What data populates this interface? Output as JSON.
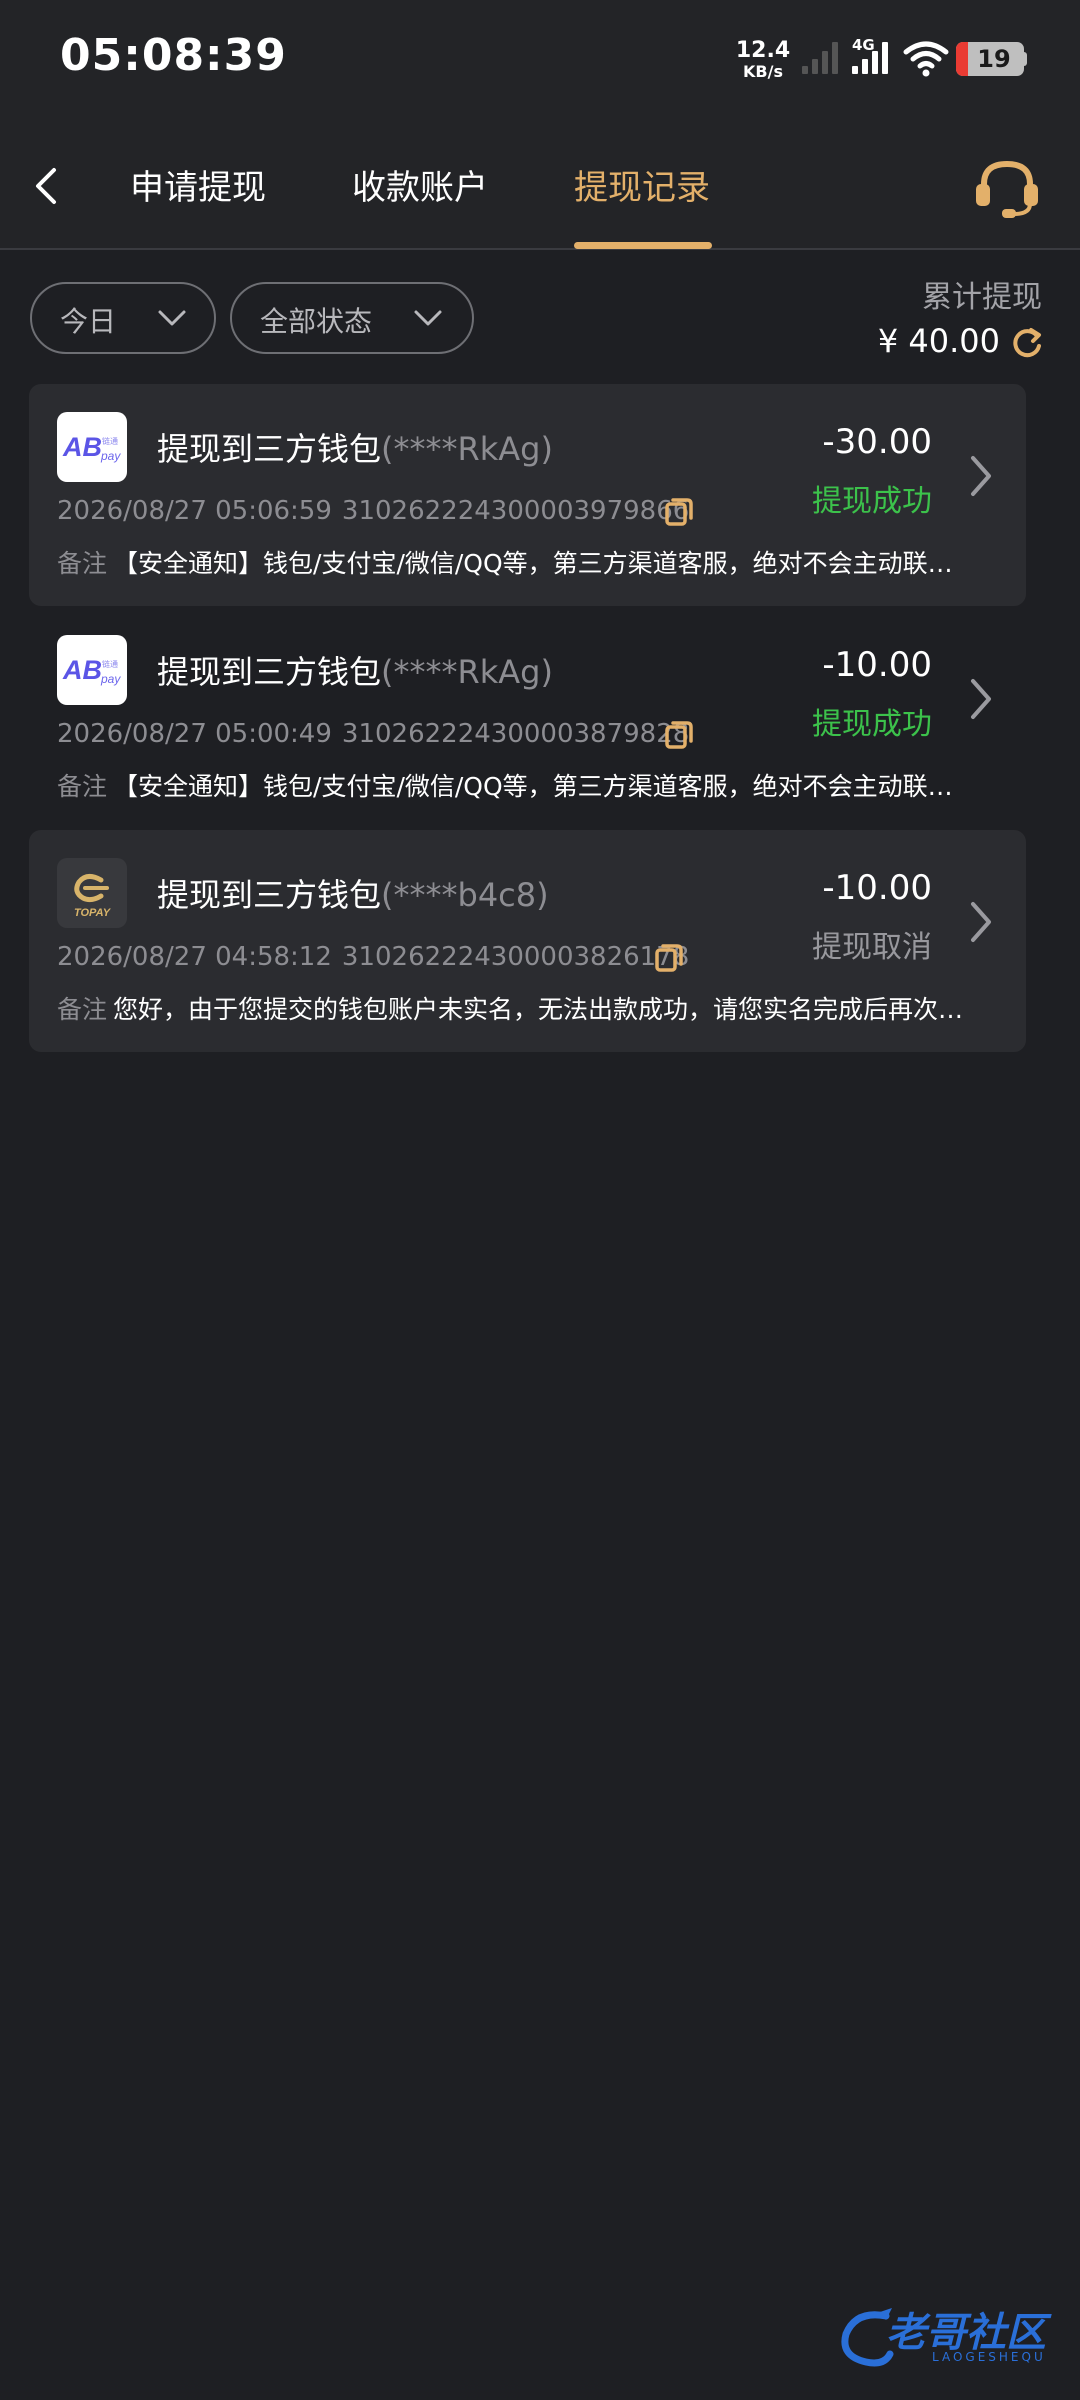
{
  "status_bar": {
    "time": "05:08:39",
    "net_speed": "12.4",
    "net_unit": "KB/s",
    "network_type": "4G",
    "battery": "19",
    "battery_low_color": "#ea3b33"
  },
  "header": {
    "tabs": [
      {
        "label": "申请提现",
        "active": false
      },
      {
        "label": "收款账户",
        "active": false
      },
      {
        "label": "提现记录",
        "active": true
      }
    ],
    "accent_color": "#e3b06a",
    "back_icon": "chevron-left-icon",
    "support_icon": "headset-icon"
  },
  "filters": {
    "date": "今日",
    "status": "全部状态",
    "total_label": "累计提现",
    "total_amount": "¥ 40.00"
  },
  "records": [
    {
      "logo": "abpay-logo",
      "title": "提现到三方钱包",
      "account": "(****RkAg)",
      "amount": "-30.00",
      "status": "提现成功",
      "status_color": "#3cc24b",
      "datetime": "2026/08/27 05:06:59",
      "order_no": "310262224300003979866",
      "note_label": "备注",
      "note": "【安全通知】钱包/支付宝/微信/QQ等，第三方渠道客服，绝对不会主动联系您"
    },
    {
      "logo": "abpay-logo",
      "title": "提现到三方钱包",
      "account": "(****RkAg)",
      "amount": "-10.00",
      "status": "提现成功",
      "status_color": "#3cc24b",
      "datetime": "2026/08/27 05:00:49",
      "order_no": "310262224300003879828",
      "note_label": "备注",
      "note": "【安全通知】钱包/支付宝/微信/QQ等，第三方渠道客服，绝对不会主动联系您"
    },
    {
      "logo": "topay-logo",
      "title": "提现到三方钱包",
      "account": "(****b4c8)",
      "amount": "-10.00",
      "status": "提现取消",
      "status_color": "#98989d",
      "datetime": "2026/08/27 04:58:12",
      "order_no": "310262224300003826178",
      "note_label": "备注",
      "note": "您好，由于您提交的钱包账户未实名，无法出款成功，请您实名完成后再次提交"
    }
  ],
  "logos": {
    "ab_text": "AB",
    "ab_sub": "pay",
    "ab_cn": "链通",
    "topay_text": "TOPAY"
  },
  "watermark": {
    "text": "老哥社区",
    "sub": "LAOGESHEQU"
  }
}
